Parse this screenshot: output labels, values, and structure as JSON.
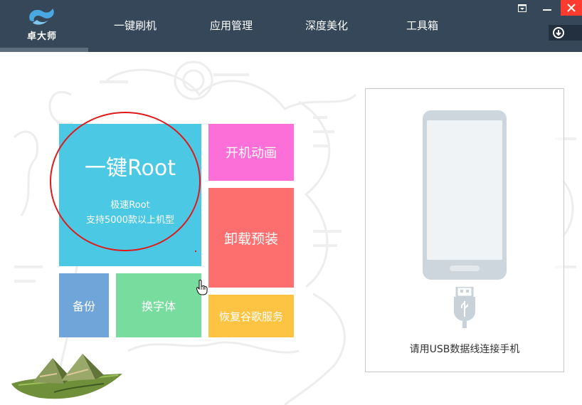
{
  "app": {
    "logo_text": "卓大师"
  },
  "nav": {
    "items": [
      {
        "label": "一键刷机"
      },
      {
        "label": "应用管理"
      },
      {
        "label": "深度美化"
      },
      {
        "label": "工具箱"
      }
    ]
  },
  "tiles": {
    "root": {
      "title": "一键Root",
      "sub1": "极速Root",
      "sub2": "支持5000款以上机型"
    },
    "boot_animation": {
      "label": "开机动画"
    },
    "uninstall_preinstalled": {
      "label": "卸载预装"
    },
    "backup": {
      "label": "备份"
    },
    "change_font": {
      "label": "换字体"
    },
    "restore_google": {
      "label": "恢复谷歌服务"
    }
  },
  "device_panel": {
    "hint": "请用USB数据线连接手机"
  },
  "colors": {
    "topbar": "#364759",
    "root_tile": "#4bc8e3",
    "boot_tile": "#fc6ed8",
    "uninstall_tile": "#fd6e6e",
    "backup_tile": "#6fa5d8",
    "font_tile": "#78dc9e",
    "google_tile": "#fdc444",
    "close_button": "#ff3b30",
    "highlight_circle": "#e0191c"
  }
}
